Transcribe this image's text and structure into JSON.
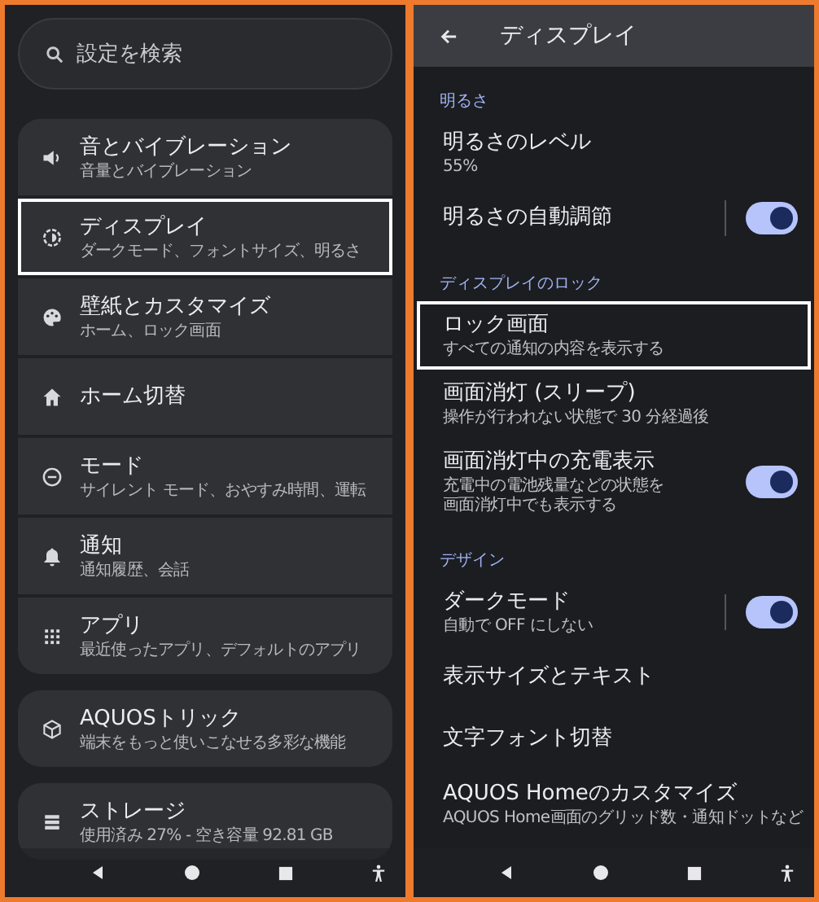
{
  "left": {
    "search": {
      "placeholder": "設定を検索"
    },
    "groups": [
      {
        "items": [
          {
            "title": "音とバイブレーション",
            "subtitle": "音量とバイブレーション",
            "highlighted": false
          },
          {
            "title": "ディスプレイ",
            "subtitle": "ダークモード、フォントサイズ、明るさ",
            "highlighted": true
          },
          {
            "title": "壁紙とカスタマイズ",
            "subtitle": "ホーム、ロック画面",
            "highlighted": false
          },
          {
            "title": "ホーム切替",
            "highlighted": false
          },
          {
            "title": "モード",
            "subtitle": "サイレント モード、おやすみ時間、運転",
            "highlighted": false
          },
          {
            "title": "通知",
            "subtitle": "通知履歴、会話",
            "highlighted": false
          },
          {
            "title": "アプリ",
            "subtitle": "最近使ったアプリ、デフォルトのアプリ",
            "highlighted": false
          }
        ]
      },
      {
        "items": [
          {
            "title": "AQUOSトリック",
            "subtitle": "端末をもっと使いこなせる多彩な機能",
            "highlighted": false
          }
        ]
      },
      {
        "items": [
          {
            "title": "ストレージ",
            "subtitle": "使用済み 27% - 空き容量 92.81 GB",
            "highlighted": false
          }
        ]
      }
    ]
  },
  "right": {
    "header": {
      "title": "ディスプレイ"
    },
    "sections": [
      {
        "heading": "明るさ",
        "items": [
          {
            "kind": "plain",
            "title": "明るさのレベル",
            "subtitle": "55%",
            "highlighted": false
          },
          {
            "kind": "split-toggle",
            "title": "明るさの自動調節",
            "on": true,
            "highlighted": false
          }
        ]
      },
      {
        "heading": "ディスプレイのロック",
        "items": [
          {
            "kind": "plain",
            "title": "ロック画面",
            "subtitle": "すべての通知の内容を表示する",
            "highlighted": true
          },
          {
            "kind": "plain",
            "title": "画面消灯 (スリープ)",
            "subtitle": "操作が行われない状態で 30 分経過後",
            "highlighted": false
          },
          {
            "kind": "toggle",
            "title": "画面消灯中の充電表示",
            "subtitle": "充電中の電池残量などの状態を画面消灯中でも表示する",
            "on": true,
            "highlighted": false
          }
        ]
      },
      {
        "heading": "デザイン",
        "items": [
          {
            "kind": "split-toggle",
            "title": "ダークモード",
            "subtitle": "自動で OFF にしない",
            "on": true,
            "highlighted": false
          },
          {
            "kind": "plain",
            "title": "表示サイズとテキスト",
            "highlighted": false
          },
          {
            "kind": "plain",
            "title": "文字フォント切替",
            "highlighted": false
          },
          {
            "kind": "plain",
            "title": "AQUOS Homeのカスタマイズ",
            "subtitle": "AQUOS Home画面のグリッド数・通知ドットなど",
            "highlighted": false
          }
        ]
      }
    ]
  }
}
